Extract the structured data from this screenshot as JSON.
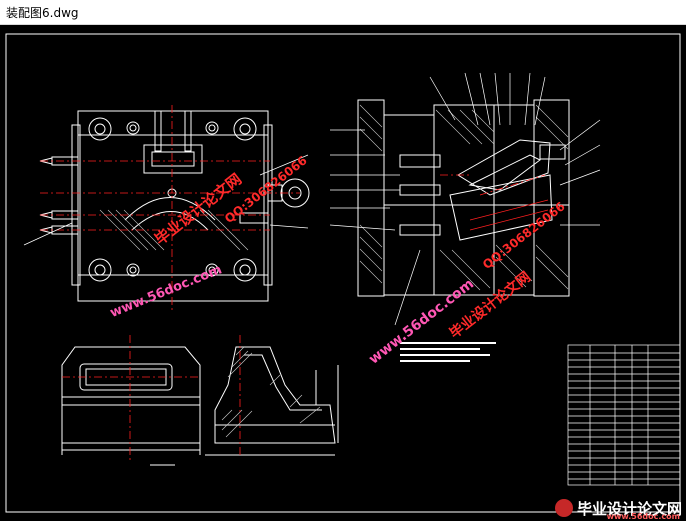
{
  "window": {
    "title": "装配图6.dwg"
  },
  "watermarks": [
    {
      "text": "毕业设计论文网",
      "color": "red"
    },
    {
      "text": "QQ:306826066",
      "color": "red"
    },
    {
      "text": "www.56doc.com",
      "color": "pink"
    },
    {
      "text": "www.56doc.com",
      "color": "pink"
    },
    {
      "text": "QQ:306826066",
      "color": "red"
    },
    {
      "text": "毕业设计论文网",
      "color": "red"
    }
  ],
  "footer": {
    "brand": "毕业设计论文网",
    "url": "www.56doc.com"
  },
  "colors": {
    "background": "#000000",
    "line_white": "#ffffff",
    "centerline_red": "#ff2020",
    "hatch_grey": "#c8c8c8"
  }
}
